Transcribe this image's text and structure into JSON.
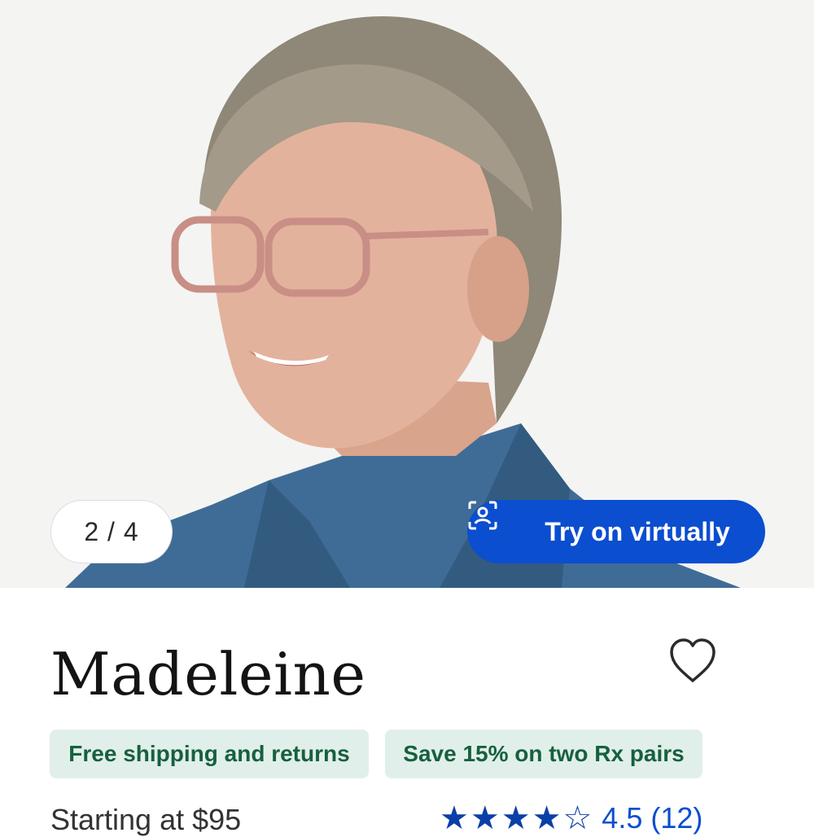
{
  "gallery": {
    "counter": "2 / 4",
    "try_on_label": "Try on virtually",
    "try_on_icon": "face-scan-icon"
  },
  "product": {
    "name": "Madeleine",
    "favorite_icon": "heart-outline-icon"
  },
  "badges": [
    {
      "label": "Free shipping and returns"
    },
    {
      "label": "Save 15% on two Rx pairs"
    }
  ],
  "pricing": {
    "starting_at": "Starting at $95"
  },
  "reviews": {
    "rating_value": 4.5,
    "stars": 5,
    "rating_text": "4.5",
    "count_text": "(12)"
  },
  "colors": {
    "accent": "#0b4ecf",
    "badge_bg": "#e1efea",
    "badge_text": "#17603f"
  }
}
